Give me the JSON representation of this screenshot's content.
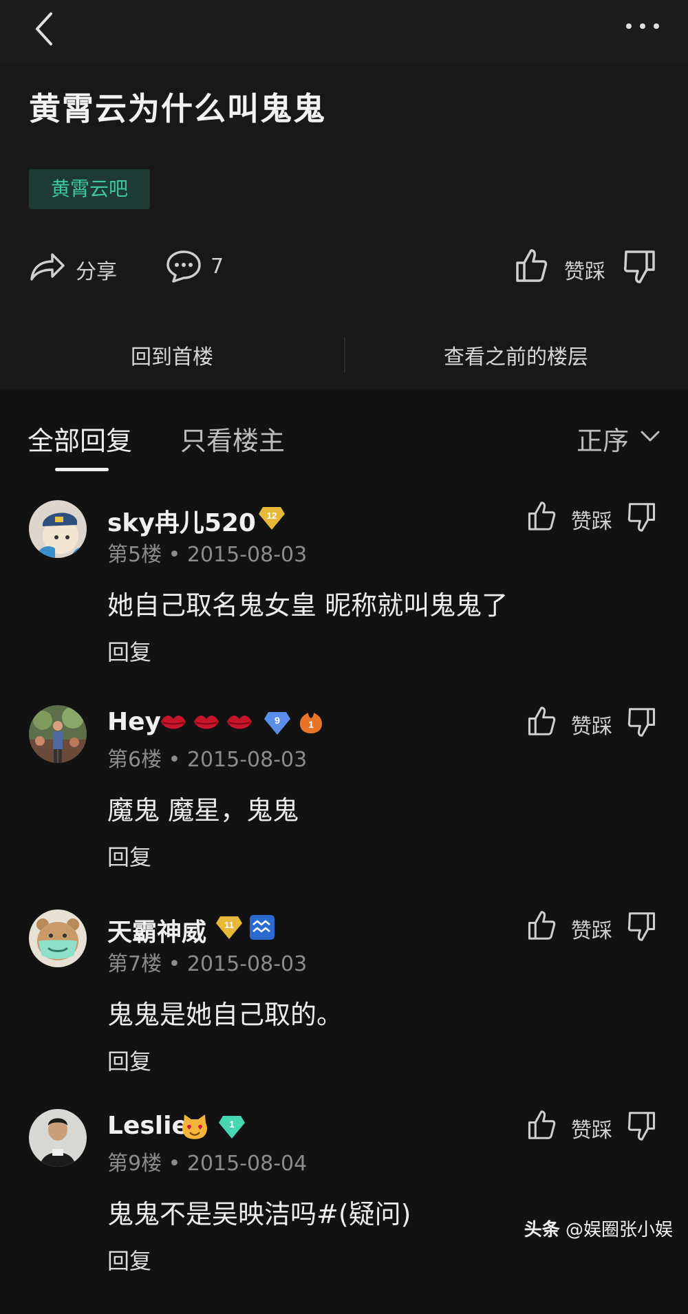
{
  "thread": {
    "title": "黄霄云为什么叫鬼鬼",
    "forum_tag": "黄霄云吧",
    "share_label": "分享",
    "comment_count": "7",
    "vote_label": "赞踩",
    "jump_first": "回到首楼",
    "jump_previous": "查看之前的楼层"
  },
  "tabs": {
    "all": "全部回复",
    "op_only": "只看楼主",
    "sort": "正序"
  },
  "posts": [
    {
      "username": "sky冉儿520",
      "floor": "第5楼",
      "date": "2015-08-03",
      "content": "她自己取名鬼女皇 昵称就叫鬼鬼了",
      "reply": "回复",
      "vote": "赞踩",
      "badges": [
        "12"
      ]
    },
    {
      "username": "Hey",
      "floor": "第6楼",
      "date": "2015-08-03",
      "content": "魔鬼 魔星，鬼鬼",
      "reply": "回复",
      "vote": "赞踩",
      "badges": [
        "9",
        "1"
      ]
    },
    {
      "username": "天霸神威",
      "floor": "第7楼",
      "date": "2015-08-03",
      "content": "鬼鬼是她自己取的。",
      "reply": "回复",
      "vote": "赞踩",
      "badges": [
        "11"
      ]
    },
    {
      "username": "Leslie",
      "floor": "第9楼",
      "date": "2015-08-04",
      "content": "鬼鬼不是吴映洁吗#(疑问)",
      "reply": "回复",
      "vote": "赞踩",
      "badges": [
        "1"
      ]
    }
  ],
  "watermark": {
    "platform": "头条",
    "account": "@娱圈张小娱"
  },
  "colors": {
    "background": "#121212",
    "tag_bg": "#1d3a33",
    "tag_text": "#40c8a0",
    "gold_badge": "#e8b838",
    "blue_badge": "#5a8ee8",
    "teal_badge": "#46d6b4"
  }
}
